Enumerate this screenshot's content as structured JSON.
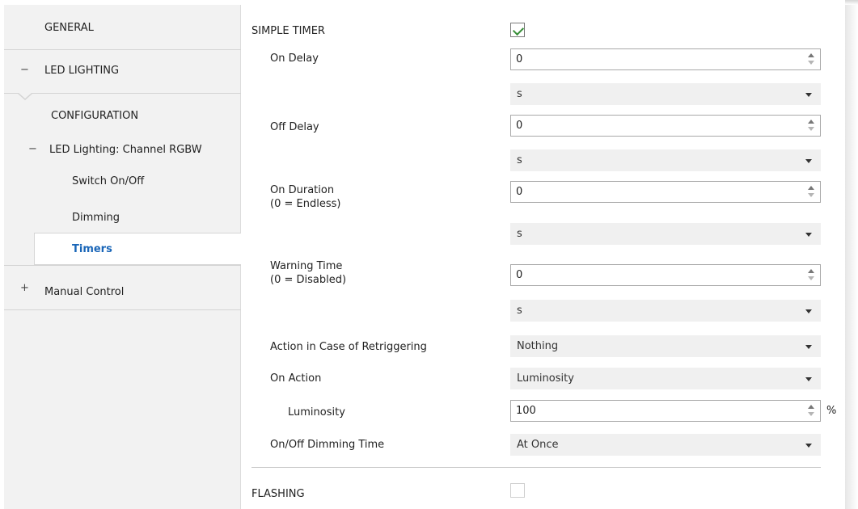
{
  "sidebar": {
    "items": [
      {
        "label": "GENERAL",
        "symbol": ""
      },
      {
        "label": "LED LIGHTING",
        "symbol": "−"
      },
      {
        "label": "CONFIGURATION",
        "symbol": ""
      },
      {
        "label": "LED Lighting: Channel RGBW",
        "symbol": "−"
      },
      {
        "label": "Switch On/Off",
        "symbol": ""
      },
      {
        "label": "Dimming",
        "symbol": ""
      },
      {
        "label": "Timers",
        "symbol": "",
        "selected": true
      },
      {
        "label": "Manual Control",
        "symbol": "+"
      }
    ]
  },
  "main": {
    "simple_timer": {
      "label": "SIMPLE TIMER",
      "checked": true
    },
    "on_delay": {
      "label": "On Delay",
      "value": "0",
      "unit": "s"
    },
    "off_delay": {
      "label": "Off Delay",
      "value": "0",
      "unit": "s"
    },
    "on_duration": {
      "label_line1": "On Duration",
      "label_line2": "(0 = Endless)",
      "value": "0",
      "unit": "s"
    },
    "warning_time": {
      "label_line1": "Warning Time",
      "label_line2": "(0 = Disabled)",
      "value": "0",
      "unit": "s"
    },
    "retrigger": {
      "label": "Action in Case of Retriggering",
      "value": "Nothing"
    },
    "on_action": {
      "label": "On Action",
      "value": "Luminosity"
    },
    "luminosity": {
      "label": "Luminosity",
      "value": "100",
      "unit": "%"
    },
    "dimming_time": {
      "label": "On/Off Dimming Time",
      "value": "At Once"
    },
    "flashing": {
      "label": "FLASHING",
      "checked": false
    }
  },
  "colors": {
    "accent": "#1a66b8",
    "sidebar_bg": "#f2f2f2",
    "check": "#3a8f3a"
  }
}
